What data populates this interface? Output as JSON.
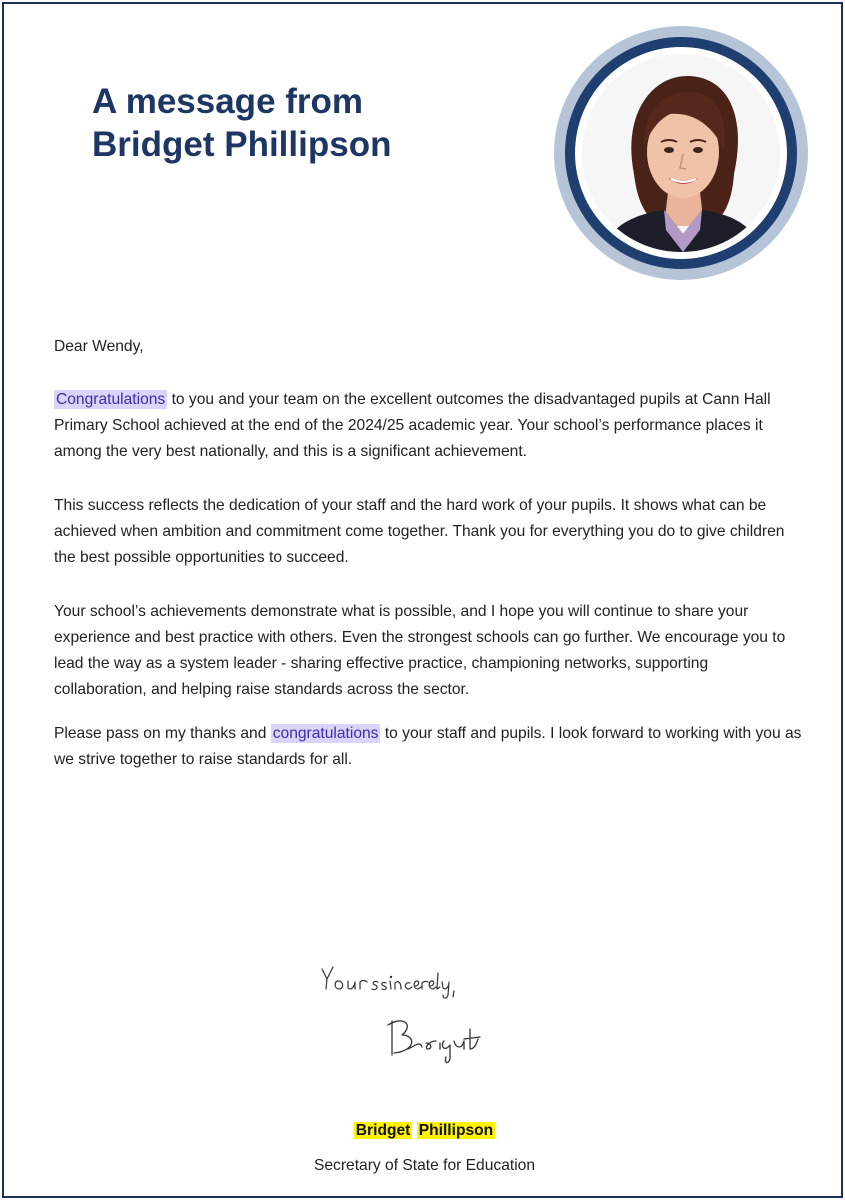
{
  "header": {
    "title_line1": "A message from",
    "title_line2": "Bridget Phillipson"
  },
  "colors": {
    "title": "#1e3663",
    "border": "#1c2f55",
    "ring_outer": "#b6c4d8",
    "ring_inner": "#1f3f70",
    "highlight_purple": "#dcd3fb",
    "highlight_yellow": "#fff200"
  },
  "letter": {
    "salutation": "Dear Wendy,",
    "p1_highlight": "Congratulations",
    "p1_rest": " to you and your team on the excellent outcomes the disadvantaged pupils at Cann Hall Primary School achieved at the end of the 2024/25 academic year. Your school’s performance places it among the very best nationally, and this is a significant achievement.",
    "p2": "This success reflects the dedication of your staff and the hard work of your pupils. It shows what can be achieved when ambition and commitment come together. Thank you for everything you do to give children the best possible opportunities to succeed.",
    "p3": "Your school’s achievements demonstrate what is possible, and I hope you will continue to share your experience and best practice with others. Even the strongest schools can go further. We encourage you to lead the way as a system leader - sharing effective practice, championing networks, supporting collaboration, and helping raise standards across the sector.",
    "p4_before": "Please pass on my thanks and ",
    "p4_highlight": "congratulations",
    "p4_after": " to your staff and pupils. I look forward to working with you as we strive together to raise standards for all."
  },
  "closing": {
    "handwritten_closing": "Yours sincerely,",
    "handwritten_signature": "Bridget"
  },
  "signatory": {
    "first_name": "Bridget",
    "last_name": "Phillipson",
    "role": "Secretary of State for Education"
  }
}
